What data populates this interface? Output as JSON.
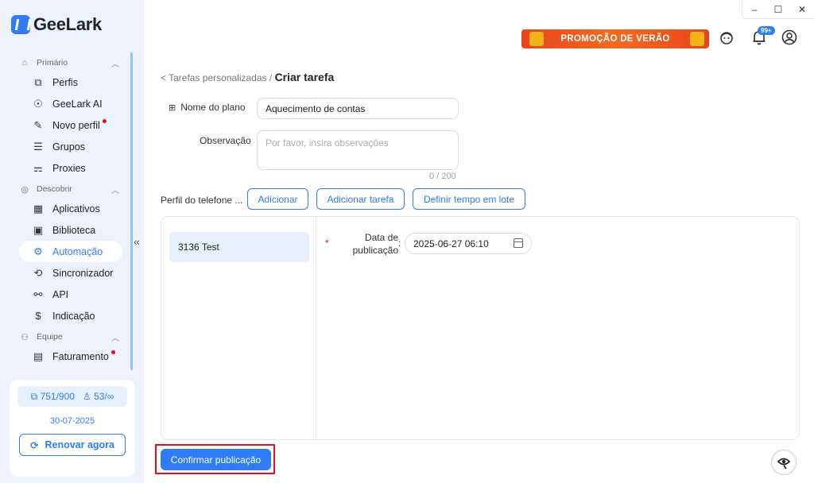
{
  "app": {
    "logo_text": "GeeLark"
  },
  "window": {
    "minimize": "–",
    "maximize": "☐",
    "close": "✕"
  },
  "sidebar": {
    "sections": [
      {
        "label": "Primário",
        "items": [
          {
            "label": "Perfis",
            "icon": "profiles-icon"
          },
          {
            "label": "GeeLark AI",
            "icon": "ai-icon"
          },
          {
            "label": "Novo perfil",
            "icon": "edit-icon",
            "dot": true
          },
          {
            "label": "Grupos",
            "icon": "list-icon"
          },
          {
            "label": "Proxies",
            "icon": "network-icon"
          }
        ]
      },
      {
        "label": "Descobrir",
        "items": [
          {
            "label": "Aplicativos",
            "icon": "apps-icon"
          },
          {
            "label": "Biblioteca",
            "icon": "library-icon"
          },
          {
            "label": "Automação",
            "icon": "robot-icon",
            "active": true
          },
          {
            "label": "Sincronizador",
            "icon": "sync-icon"
          },
          {
            "label": "API",
            "icon": "api-icon"
          },
          {
            "label": "Indicação",
            "icon": "dollar-icon"
          }
        ]
      },
      {
        "label": "Equipe",
        "items": [
          {
            "label": "Faturamento",
            "icon": "wallet-icon",
            "dot": true
          }
        ]
      }
    ],
    "quota": {
      "profiles": "751/900",
      "members": "53/∞",
      "date": "30-07-2025",
      "renew_label": "Renovar agora"
    }
  },
  "header": {
    "promo_text": "PROMOÇÃO DE VERÃO",
    "notification_badge": "99+"
  },
  "breadcrumb": {
    "parent": "< Tarefas personalizadas",
    "separator": "/",
    "current": "Criar tarefa"
  },
  "form": {
    "plan_name_label": "Nome do plano",
    "plan_name_value": "Aquecimento de contas",
    "observation_label": "Observação",
    "observation_placeholder": "Por favor, insira observações",
    "observation_counter": "0 / 200",
    "phone_profile_label": "Perfil do telefone ...",
    "add_button": "Adicionar",
    "add_task_button": "Adicionar tarefa",
    "batch_time_button": "Definir tempo em lote",
    "profiles": [
      "3136 Test"
    ],
    "required_mark": "*",
    "publish_date_label": "Data de publicação",
    "publish_date_colon": ":",
    "publish_date_value": "2025-06-27 06:10",
    "confirm_button": "Confirmar publicação"
  }
}
